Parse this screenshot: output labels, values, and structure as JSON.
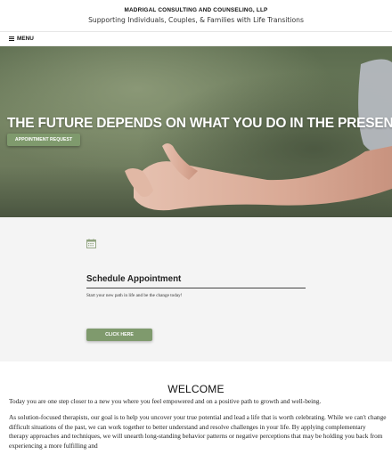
{
  "header": {
    "brand_name": "MADRIGAL CONSULTING AND COUNSELING, LLP",
    "tagline": "Supporting Individuals, Couples, & Families with Life Transitions"
  },
  "nav": {
    "menu_icon": "hamburger-icon",
    "menu_label": "MENU"
  },
  "hero": {
    "heading": "THE FUTURE DEPENDS ON WHAT YOU DO IN THE PRESENT",
    "button_label": "APPOINTMENT REQUEST"
  },
  "schedule": {
    "icon": "calendar-icon",
    "title": "Schedule Appointment",
    "text": "Start your new path in life and be the change today!",
    "button_label": "CLICK HERE"
  },
  "welcome": {
    "title": "WELCOME",
    "paragraph1": "Today you are one step closer to a new you where you feel empowered and on a positive path to growth and well-being.",
    "paragraph2": "As solution-focused therapists, our goal is to help you uncover your true potential and lead a life that is worth celebrating. While we can't change difficult situations of the past, we can work together to better understand and resolve challenges in your life. By applying complementary therapy approaches and techniques, we will unearth long-standing behavior patterns or negative perceptions that may be holding you back from experiencing a more fulfilling and"
  },
  "colors": {
    "accent": "#7f9a6d",
    "section_bg": "#f4f4f4"
  }
}
